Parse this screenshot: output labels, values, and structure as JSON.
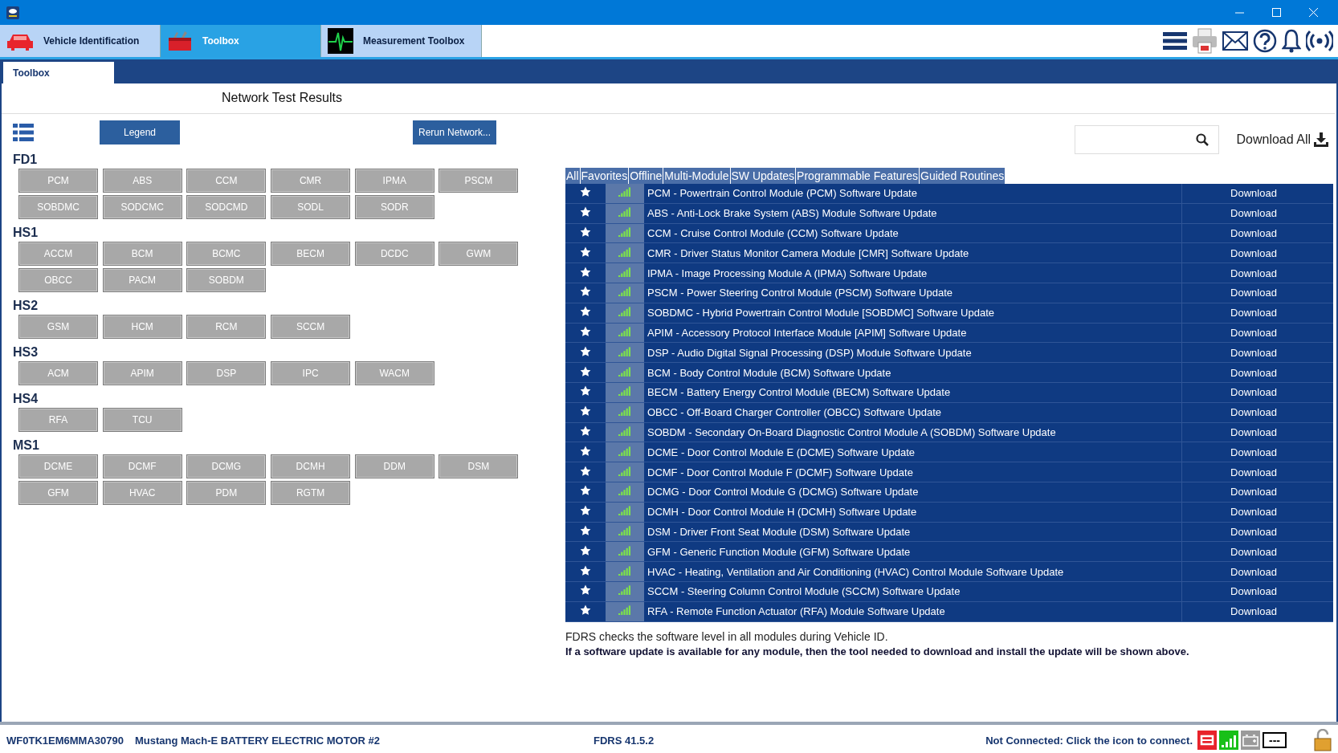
{
  "tabs": [
    {
      "label": "Vehicle Identification",
      "kind": "car",
      "selected": false
    },
    {
      "label": "Toolbox",
      "kind": "toolbox",
      "selected": true
    },
    {
      "label": "Measurement Toolbox",
      "kind": "scope",
      "selected": false
    }
  ],
  "subtabs": [
    {
      "label": "Toolbox",
      "selected": true
    }
  ],
  "network": {
    "title": "Network Test Results",
    "legend_button": "Legend",
    "rerun_button": "Rerun Network...",
    "groups": [
      {
        "name": "FD1",
        "modules": [
          "PCM",
          "ABS",
          "CCM",
          "CMR",
          "IPMA",
          "PSCM",
          "SOBDMC",
          "SODCMC",
          "SODCMD",
          "SODL",
          "SODR"
        ]
      },
      {
        "name": "HS1",
        "modules": [
          "ACCM",
          "BCM",
          "BCMC",
          "BECM",
          "DCDC",
          "GWM",
          "OBCC",
          "PACM",
          "SOBDM"
        ]
      },
      {
        "name": "HS2",
        "modules": [
          "GSM",
          "HCM",
          "RCM",
          "SCCM"
        ]
      },
      {
        "name": "HS3",
        "modules": [
          "ACM",
          "APIM",
          "DSP",
          "IPC",
          "WACM"
        ]
      },
      {
        "name": "HS4",
        "modules": [
          "RFA",
          "TCU"
        ]
      },
      {
        "name": "MS1",
        "modules": [
          "DCME",
          "DCMF",
          "DCMG",
          "DCMH",
          "DDM",
          "DSM",
          "GFM",
          "HVAC",
          "PDM",
          "RGTM"
        ]
      }
    ]
  },
  "toolbox": {
    "download_all": "Download All",
    "filters": [
      "All",
      "Favorites",
      "Offline",
      "Multi-Module",
      "SW Updates",
      "Programmable Features",
      "Guided Routines"
    ],
    "rows": [
      {
        "name": "PCM - Powertrain Control Module (PCM) Software Update",
        "action": "Download"
      },
      {
        "name": "ABS - Anti-Lock Brake System (ABS) Module Software Update",
        "action": "Download"
      },
      {
        "name": "CCM - Cruise Control Module (CCM) Software Update",
        "action": "Download"
      },
      {
        "name": "CMR - Driver Status Monitor Camera Module [CMR] Software Update",
        "action": "Download"
      },
      {
        "name": "IPMA - Image Processing Module A (IPMA) Software Update",
        "action": "Download"
      },
      {
        "name": "PSCM - Power Steering Control Module (PSCM) Software Update",
        "action": "Download"
      },
      {
        "name": "SOBDMC - Hybrid Powertrain Control Module [SOBDMC] Software Update",
        "action": "Download"
      },
      {
        "name": "APIM - Accessory Protocol Interface Module [APIM] Software Update",
        "action": "Download"
      },
      {
        "name": "DSP - Audio Digital Signal Processing (DSP) Module Software Update",
        "action": "Download"
      },
      {
        "name": "BCM - Body Control Module (BCM) Software Update",
        "action": "Download"
      },
      {
        "name": "BECM - Battery Energy Control Module (BECM) Software Update",
        "action": "Download"
      },
      {
        "name": "OBCC - Off-Board Charger Controller (OBCC) Software Update",
        "action": "Download"
      },
      {
        "name": "SOBDM - Secondary On-Board Diagnostic Control Module A (SOBDM) Software Update",
        "action": "Download"
      },
      {
        "name": "DCME - Door Control Module E (DCME) Software Update",
        "action": "Download"
      },
      {
        "name": "DCMF - Door Control Module F (DCMF) Software Update",
        "action": "Download"
      },
      {
        "name": "DCMG - Door Control Module G (DCMG) Software Update",
        "action": "Download"
      },
      {
        "name": "DCMH - Door Control Module H (DCMH) Software Update",
        "action": "Download"
      },
      {
        "name": "DSM - Driver Front Seat Module (DSM) Software Update",
        "action": "Download"
      },
      {
        "name": "GFM - Generic Function Module (GFM) Software Update",
        "action": "Download"
      },
      {
        "name": "HVAC - Heating, Ventilation and Air Conditioning (HVAC) Control Module Software Update",
        "action": "Download"
      },
      {
        "name": "SCCM - Steering Column Control Module (SCCM) Software Update",
        "action": "Download"
      },
      {
        "name": "RFA - Remote Function Actuator (RFA) Module Software Update",
        "action": "Download"
      }
    ],
    "note": "FDRS checks the software level in all modules during Vehicle ID.",
    "note_bold": "If a software update is available for any module, then the tool needed to download and install the update will be shown above."
  },
  "status_bar": {
    "vin": "WF0TK1EM6MMA30790",
    "vehicle": "Mustang Mach-E BATTERY ELECTRIC MOTOR #2",
    "version": "FDRS 41.5.2",
    "connection": "Not Connected: Click the icon to connect.",
    "adapter_text": "---"
  }
}
